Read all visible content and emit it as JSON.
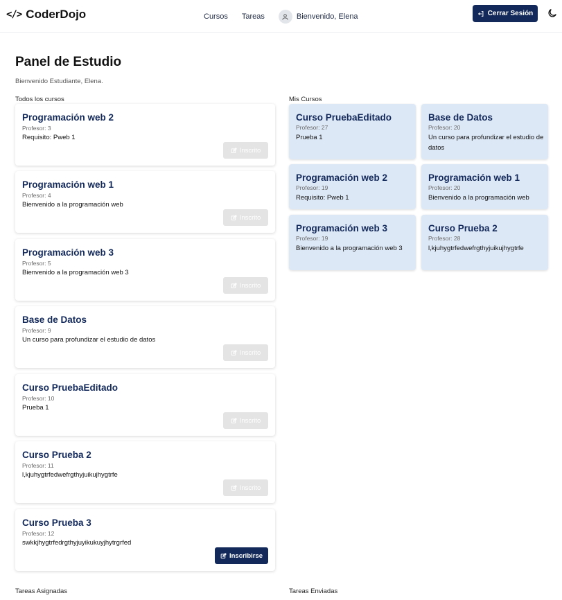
{
  "brand": {
    "icon_text": "</>",
    "name": "CoderDojo"
  },
  "nav": {
    "links": [
      "Cursos",
      "Tareas"
    ],
    "welcome": "Bienvenido, Elena",
    "logout_label": "Cerrar Sesión"
  },
  "page": {
    "title": "Panel de Estudio",
    "subtitle": "Bienvenido Estudiante, Elena.",
    "all_courses_label": "Todos los cursos",
    "my_courses_label": "Mis Cursos",
    "assigned_tasks_label": "Tareas Asignadas",
    "sent_tasks_label": "Tareas Enviadas"
  },
  "all_courses": [
    {
      "title": "Programación web 2",
      "professor": "Profesor: 3",
      "description": "Requisito: Pweb 1",
      "button": "Inscrito",
      "enrolled": true
    },
    {
      "title": "Programación web 1",
      "professor": "Profesor: 4",
      "description": "Bienvenido a la programación web",
      "button": "Inscrito",
      "enrolled": true
    },
    {
      "title": "Programación web 3",
      "professor": "Profesor: 5",
      "description": "Bienvenido a la programación web 3",
      "button": "Inscrito",
      "enrolled": true
    },
    {
      "title": "Base de Datos",
      "professor": "Profesor: 9",
      "description": "Un curso para profundizar el estudio de datos",
      "button": "Inscrito",
      "enrolled": true
    },
    {
      "title": "Curso PruebaEditado",
      "professor": "Profesor: 10",
      "description": "Prueba 1",
      "button": "Inscrito",
      "enrolled": true
    },
    {
      "title": "Curso Prueba 2",
      "professor": "Profesor: 11",
      "description": "l,kjuhygtrfedwefrgthyjuikujhygtrfe",
      "button": "Inscrito",
      "enrolled": true
    },
    {
      "title": "Curso Prueba 3",
      "professor": "Profesor: 12",
      "description": "swkkjhygtrfedrgthyjuyikukuyjhytrgrfed",
      "button": "Inscribirse",
      "enrolled": false
    }
  ],
  "my_courses": [
    {
      "title": "Curso PruebaEditado",
      "professor": "Profesor: 27",
      "description": "Prueba 1"
    },
    {
      "title": "Base de Datos",
      "professor": "Profesor: 20",
      "description": "Un curso para profundizar el estudio de datos"
    },
    {
      "title": "Programación web 2",
      "professor": "Profesor: 19",
      "description": "Requisito: Pweb 1"
    },
    {
      "title": "Programación web 1",
      "professor": "Profesor: 20",
      "description": "Bienvenido a la programación web"
    },
    {
      "title": "Programación web 3",
      "professor": "Profesor: 19",
      "description": "Bienvenido a la programación web 3"
    },
    {
      "title": "Curso Prueba 2",
      "professor": "Profesor: 28",
      "description": "l,kjuhygtrfedwefrgthyjuikujhygtrfe"
    }
  ],
  "colors": {
    "primary": "#13295a",
    "my_course_bg": "#dde8f6",
    "disabled_button": "#e4e4e4"
  },
  "icons": {
    "brand": "code-icon",
    "user": "user-icon",
    "logout": "logout-icon",
    "theme": "moon-icon",
    "edit": "edit-square-icon"
  }
}
